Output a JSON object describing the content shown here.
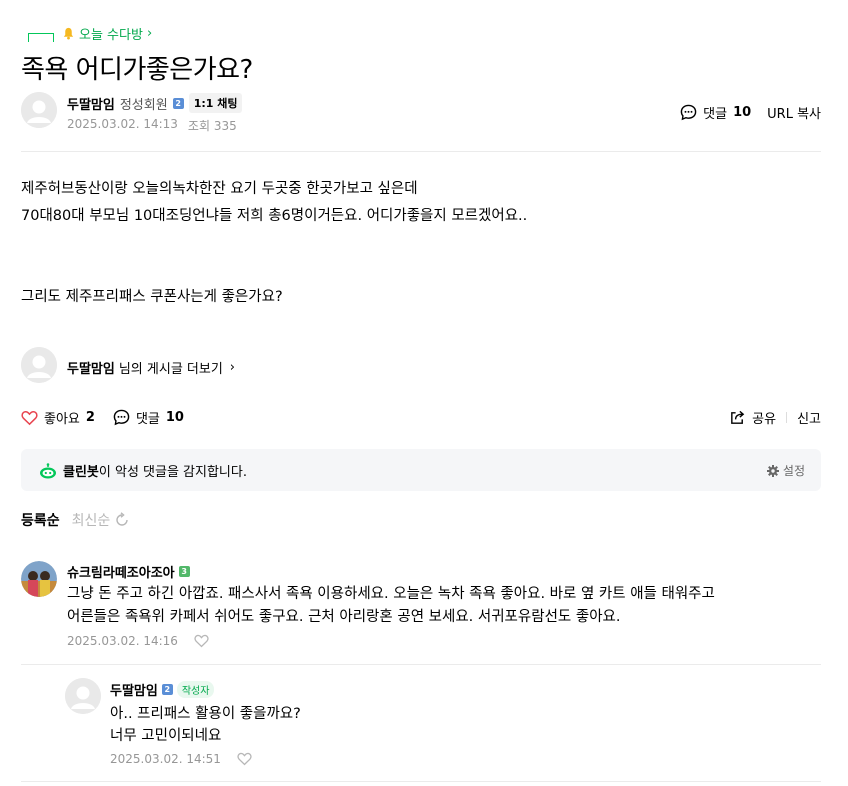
{
  "board": {
    "name": "오늘 수다방",
    "chevron": "›"
  },
  "post": {
    "title": "족욕 어디가좋은가요?",
    "author": "두딸맘임",
    "grade": "정성회원",
    "level_badge": "2",
    "chat_label": "1:1 채팅",
    "date": "2025.03.02. 14:13",
    "views_label": "조회 335",
    "comment_label": "댓글",
    "comment_count": "10",
    "url_copy": "URL 복사",
    "body_lines": [
      "제주허브동산이랑 오늘의녹차한잔 요기 두곳중 한곳가보고 싶은데",
      "70대80대 부모님 10대조딩언냐들 저희 총6명이거든요. 어디가좋을지 모르겠어요..",
      "그리도 제주프리패스 쿠폰사는게 좋은가요?"
    ],
    "more_author": "두딸맘임",
    "more_suffix": "님의 게시글 더보기",
    "like_label": "좋아요",
    "like_count": "2",
    "share_label": "공유",
    "report_label": "신고"
  },
  "cleanbot": {
    "name": "클린봇",
    "text": "이 악성 댓글을 감지합니다.",
    "settings": "설정"
  },
  "sort": {
    "active": "등록순",
    "inactive": "최신순"
  },
  "comments": [
    {
      "author": "슈크림라떼조아조아",
      "badge": "3",
      "lines": [
        "그냥 돈 주고 하긴 아깝죠. 패스사서 족욕 이용하세요. 오늘은 녹차 족욕 좋아요. 바로 옆 카트 애들 태워주고",
        "어른들은 족욕위 카페서 쉬어도 좋구요. 근처 아리랑혼 공연 보세요. 서귀포유람선도 좋아요."
      ],
      "date": "2025.03.02. 14:16"
    },
    {
      "author": "두딸맘임",
      "badge": "2",
      "writer_tag": "작성자",
      "lines": [
        "아.. 프리패스 활용이 좋을까요?",
        "너무 고민이되네요"
      ],
      "date": "2025.03.02. 14:51"
    }
  ],
  "colors": {
    "accent": "#03c75a",
    "heart": "#e8444f",
    "muted": "#979797"
  },
  "icons": [
    "bell-icon",
    "chevron-right-icon",
    "comment-bubble-icon",
    "heart-icon",
    "share-icon",
    "gear-icon",
    "cleanbot-icon",
    "refresh-icon",
    "default-avatar-icon"
  ]
}
